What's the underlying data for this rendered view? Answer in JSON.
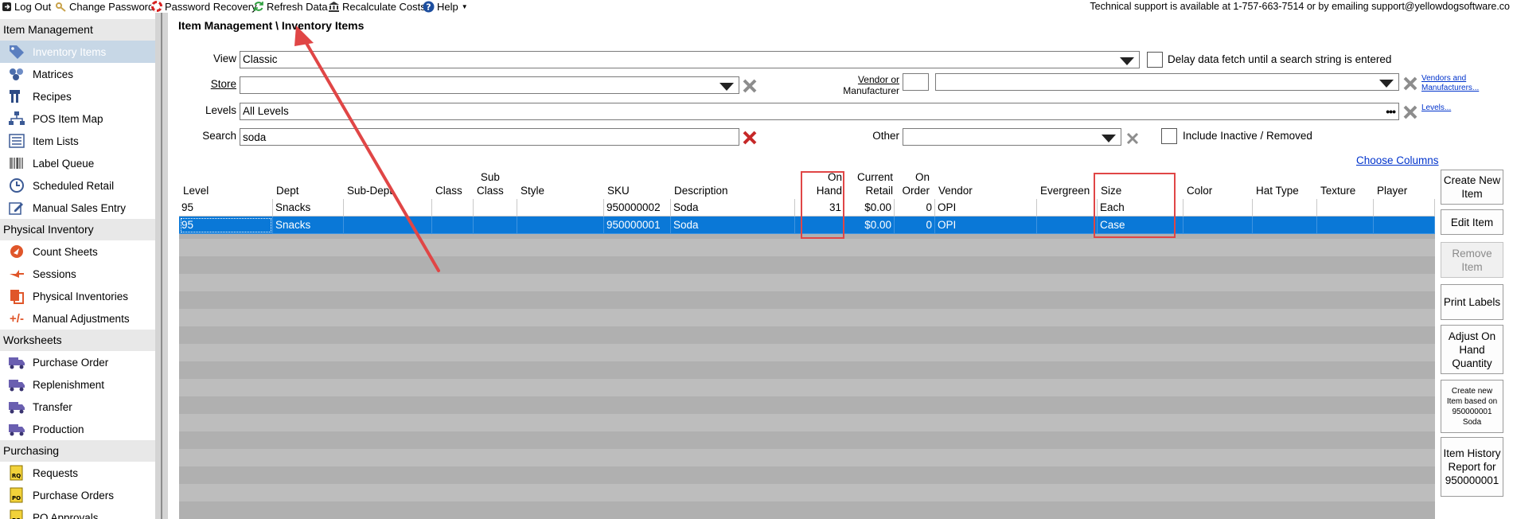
{
  "toolbar": {
    "logout": "Log Out",
    "change_password": "Change Password",
    "password_recovery": "Password Recovery",
    "refresh_data": "Refresh Data",
    "recalculate_costs": "Recalculate Costs",
    "help": "Help",
    "support_text": "Technical support is available at 1-757-663-7514 or by emailing support@yellowdogsoftware.co"
  },
  "sidebar": {
    "sections": [
      {
        "title": "Item Management",
        "items": [
          {
            "label": "Inventory Items",
            "icon": "tag-icon",
            "selected": true
          },
          {
            "label": "Matrices",
            "icon": "matrix-icon"
          },
          {
            "label": "Recipes",
            "icon": "recipe-icon"
          },
          {
            "label": "POS Item Map",
            "icon": "sitemap-icon"
          },
          {
            "label": "Item Lists",
            "icon": "list-icon"
          },
          {
            "label": "Label Queue",
            "icon": "barcode-icon"
          },
          {
            "label": "Scheduled Retail",
            "icon": "clock-icon"
          },
          {
            "label": "Manual Sales Entry",
            "icon": "edit-icon"
          }
        ]
      },
      {
        "title": "Physical Inventory",
        "items": [
          {
            "label": "Count Sheets",
            "icon": "count-sheet-icon"
          },
          {
            "label": "Sessions",
            "icon": "session-icon"
          },
          {
            "label": "Physical Inventories",
            "icon": "physical-inventory-icon"
          },
          {
            "label": "Manual Adjustments",
            "icon": "plus-minus-icon"
          }
        ]
      },
      {
        "title": "Worksheets",
        "items": [
          {
            "label": "Purchase Order",
            "icon": "truck-icon"
          },
          {
            "label": "Replenishment",
            "icon": "truck-icon"
          },
          {
            "label": "Transfer",
            "icon": "truck-icon"
          },
          {
            "label": "Production",
            "icon": "truck-icon"
          }
        ]
      },
      {
        "title": "Purchasing",
        "items": [
          {
            "label": "Requests",
            "icon": "rq-icon"
          },
          {
            "label": "Purchase Orders",
            "icon": "po-icon"
          },
          {
            "label": "PO Approvals",
            "icon": "po-icon"
          }
        ]
      }
    ]
  },
  "breadcrumb": "Item Management \\ Inventory Items",
  "filters": {
    "view_label": "View",
    "view_value": "Classic",
    "delay_label": "Delay data fetch until a search string is entered",
    "store_label": "Store",
    "store_value": "",
    "vendor_label_1": "Vendor or",
    "vendor_label_2": "Manufacturer",
    "vendor_code": "",
    "vendor_value": "",
    "vendors_link_1": "Vendors and",
    "vendors_link_2": "Manufacturers...",
    "levels_label": "Levels",
    "levels_value": "All Levels",
    "levels_link": "Levels...",
    "search_label": "Search",
    "search_value": "soda",
    "other_label": "Other",
    "other_value": "",
    "include_inactive_label": "Include Inactive / Removed",
    "choose_columns": "Choose Columns"
  },
  "grid": {
    "headers": [
      {
        "key": "level",
        "l1": "",
        "l2": "Level"
      },
      {
        "key": "dept",
        "l1": "",
        "l2": "Dept"
      },
      {
        "key": "subdept",
        "l1": "",
        "l2": "Sub-Dept"
      },
      {
        "key": "class",
        "l1": "",
        "l2": "Class"
      },
      {
        "key": "subclass",
        "l1": "Sub",
        "l2": "Class"
      },
      {
        "key": "style",
        "l1": "",
        "l2": "Style"
      },
      {
        "key": "sku",
        "l1": "",
        "l2": "SKU"
      },
      {
        "key": "description",
        "l1": "",
        "l2": "Description"
      },
      {
        "key": "onhand",
        "l1": "On",
        "l2": "Hand"
      },
      {
        "key": "retail",
        "l1": "Current",
        "l2": "Retail"
      },
      {
        "key": "onorder",
        "l1": "On",
        "l2": "Order"
      },
      {
        "key": "vendor",
        "l1": "",
        "l2": "Vendor"
      },
      {
        "key": "evergreen",
        "l1": "",
        "l2": "Evergreen"
      },
      {
        "key": "size",
        "l1": "",
        "l2": "Size"
      },
      {
        "key": "color",
        "l1": "",
        "l2": "Color"
      },
      {
        "key": "hattype",
        "l1": "",
        "l2": "Hat Type"
      },
      {
        "key": "texture",
        "l1": "",
        "l2": "Texture"
      },
      {
        "key": "player",
        "l1": "",
        "l2": "Player"
      }
    ],
    "rows": [
      {
        "level": "95",
        "dept": "Snacks",
        "subdept": "",
        "class": "",
        "subclass": "",
        "style": "",
        "sku": "950000002",
        "description": "Soda",
        "onhand": "31",
        "retail": "$0.00",
        "onorder": "0",
        "vendor": "OPI",
        "evergreen": "",
        "size": "Each",
        "color": "",
        "hattype": "",
        "texture": "",
        "player": ""
      },
      {
        "level": "95",
        "dept": "Snacks",
        "subdept": "",
        "class": "",
        "subclass": "",
        "style": "",
        "sku": "950000001",
        "description": "Soda",
        "onhand": "",
        "retail": "$0.00",
        "onorder": "0",
        "vendor": "OPI",
        "evergreen": "",
        "size": "Case",
        "color": "",
        "hattype": "",
        "texture": "",
        "player": ""
      }
    ]
  },
  "actions": {
    "create_new_item": "Create New Item",
    "edit_item": "Edit Item",
    "remove_item": "Remove Item",
    "print_labels": "Print Labels",
    "adjust_on_hand": "Adjust On Hand Quantity",
    "create_based_on": "Create new Item based on 950000001 Soda",
    "item_history": "Item History Report for 950000001"
  },
  "colors": {
    "selection": "#0a78d7",
    "annotation_red": "#e04646",
    "sidebar_selected": "#c7d7e6",
    "link": "#0033cc"
  }
}
